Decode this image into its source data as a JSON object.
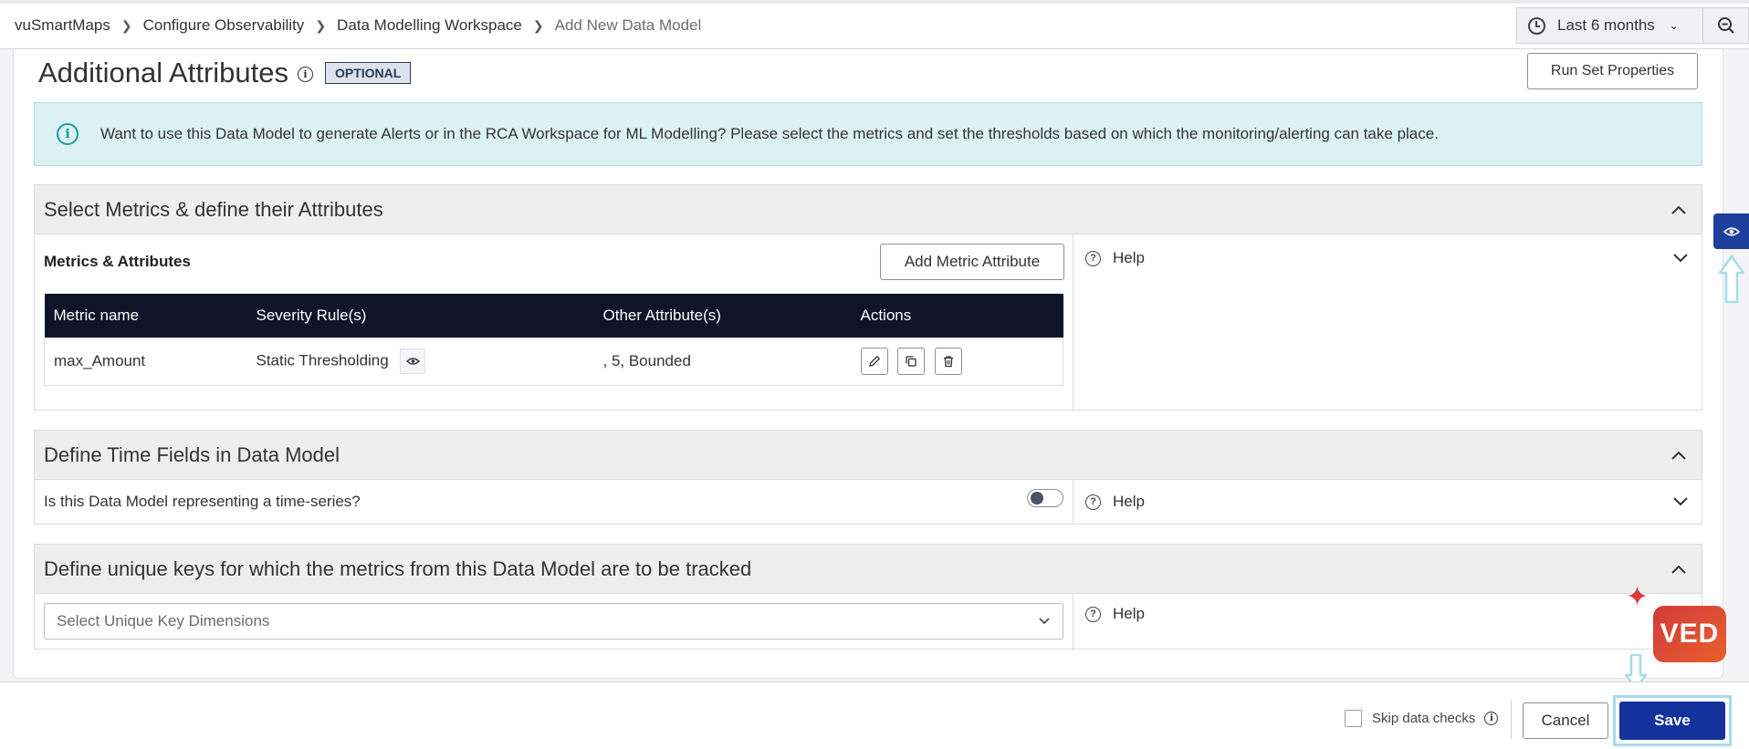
{
  "breadcrumb": {
    "items": [
      "vuSmartMaps",
      "Configure Observability",
      "Data Modelling Workspace"
    ],
    "current": "Add New Data Model"
  },
  "time_picker": {
    "label": "Last 6 months",
    "icon": "clock-icon"
  },
  "page": {
    "title": "Additional Attributes",
    "badge": "OPTIONAL",
    "run_button": "Run Set Properties"
  },
  "alert": {
    "text": "Want to use this Data Model to generate Alerts or in the RCA Workspace for ML Modelling? Please select the metrics and set the thresholds based on which the monitoring/alerting can take place."
  },
  "metrics_section": {
    "title": "Select Metrics & define their Attributes",
    "subheading": "Metrics & Attributes",
    "add_button": "Add Metric Attribute",
    "columns": [
      "Metric name",
      "Severity Rule(s)",
      "Other Attribute(s)",
      "Actions"
    ],
    "rows": [
      {
        "metric": "max_Amount",
        "severity": "Static Thresholding",
        "other": ", 5, Bounded"
      }
    ],
    "help_label": "Help"
  },
  "time_section": {
    "title": "Define Time Fields in Data Model",
    "question": "Is this Data Model representing a time-series?",
    "toggle_on": false,
    "help_label": "Help"
  },
  "keys_section": {
    "title": "Define unique keys for which the metrics from this Data Model are to be tracked",
    "placeholder": "Select Unique Key Dimensions",
    "help_label": "Help"
  },
  "footer": {
    "skip_label": "Skip data checks",
    "skip_checked": false,
    "cancel": "Cancel",
    "save": "Save"
  },
  "logo": {
    "text": "VED"
  },
  "colors": {
    "primary": "#14329b",
    "table_header": "#0f1526",
    "alert_bg": "#dcf1f4",
    "accent_teal": "#1b9aa3",
    "annotation": "#a6dce6"
  }
}
